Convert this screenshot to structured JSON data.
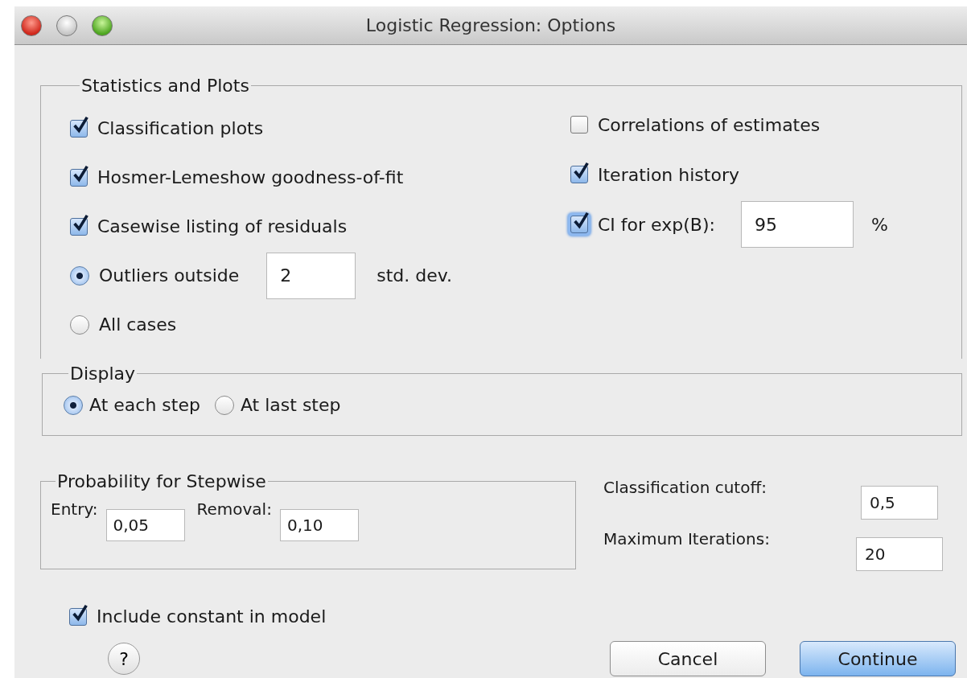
{
  "window": {
    "title": "Logistic Regression: Options"
  },
  "statistics_and_plots": {
    "title": "Statistics and Plots",
    "left_options": [
      {
        "kind": "checkbox",
        "label": "Classification plots",
        "checked": true
      },
      {
        "kind": "checkbox",
        "label": "Hosmer-Lemeshow goodness-of-fit",
        "checked": true
      },
      {
        "kind": "checkbox",
        "label": "Casewise listing of residuals",
        "checked": true
      },
      {
        "kind": "radio",
        "label": "Outliers outside",
        "selected": true,
        "value": "2",
        "unit": "std. dev."
      },
      {
        "kind": "radio",
        "label": "All cases",
        "selected": false
      }
    ],
    "right_options": [
      {
        "kind": "checkbox",
        "label": "Correlations of estimates",
        "checked": false,
        "focused": false
      },
      {
        "kind": "checkbox",
        "label": "Iteration history",
        "checked": true,
        "focused": false
      },
      {
        "kind": "checkbox",
        "label": "CI for exp(B):",
        "checked": true,
        "focused": true,
        "value": "95",
        "unit": "%"
      }
    ]
  },
  "display": {
    "title": "Display",
    "options": [
      {
        "label": "At each step",
        "selected": true
      },
      {
        "label": "At last step",
        "selected": false
      }
    ]
  },
  "probability_for_stepwise": {
    "title": "Probability for Stepwise",
    "fields": [
      {
        "label": "Entry:",
        "value": "0,05"
      },
      {
        "label": "Removal:",
        "value": "0,10"
      }
    ]
  },
  "settings": [
    {
      "label": "Classification cutoff:",
      "value": "0,5"
    },
    {
      "label": "Maximum Iterations:",
      "value": "20"
    }
  ],
  "include_constant": {
    "label": "Include constant in model",
    "checked": true
  },
  "help_button": {
    "label": "?"
  },
  "buttons": [
    {
      "label": "Cancel",
      "default": false
    },
    {
      "label": "Continue",
      "default": true
    }
  ]
}
